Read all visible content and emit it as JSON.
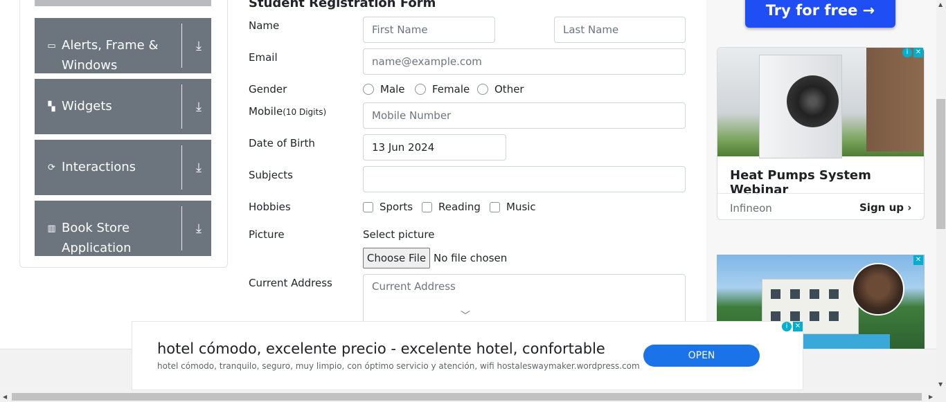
{
  "sidebar": {
    "groups": [
      {
        "icon": "window-icon",
        "label_line1": "Alerts, Frame &",
        "label_line2": "Windows"
      },
      {
        "icon": "widgets-icon",
        "label_line1": "Widgets",
        "label_line2": ""
      },
      {
        "icon": "interactions-icon",
        "label_line1": "Interactions",
        "label_line2": ""
      },
      {
        "icon": "book-icon",
        "label_line1": "Book Store",
        "label_line2": "Application"
      }
    ]
  },
  "form": {
    "title": "Student Registration Form",
    "name_label": "Name",
    "first_name_placeholder": "First Name",
    "last_name_placeholder": "Last Name",
    "email_label": "Email",
    "email_placeholder": "name@example.com",
    "gender_label": "Gender",
    "gender_options": [
      "Male",
      "Female",
      "Other"
    ],
    "mobile_label": "Mobile",
    "mobile_hint": "(10 Digits)",
    "mobile_placeholder": "Mobile Number",
    "dob_label": "Date of Birth",
    "dob_value": "13 Jun 2024",
    "subjects_label": "Subjects",
    "hobbies_label": "Hobbies",
    "hobby_options": [
      "Sports",
      "Reading",
      "Music"
    ],
    "picture_label": "Picture",
    "select_picture_label": "Select picture",
    "choose_file_label": "Choose File",
    "file_status": "No file chosen",
    "address_label": "Current Address",
    "address_placeholder": "Current Address"
  },
  "ads": {
    "try_button": "Try for free →",
    "heatpump_title": "Heat Pumps System Webinar",
    "heatpump_brand": "Infineon",
    "heatpump_cta": "Sign up",
    "bottom_headline": "hotel cómodo, excelente precio - excelente hotel, confortable",
    "bottom_sub": "hotel cómodo, tranquilo, seguro, muy limpio, con óptimo servicio y atención, wifi hostaleswaymaker.wordpress.com",
    "bottom_cta": "OPEN"
  },
  "colors": {
    "sidebar_group_bg": "#6c757d",
    "ad_button_blue": "#1f4ef5",
    "open_button_blue": "#1a73e8"
  }
}
